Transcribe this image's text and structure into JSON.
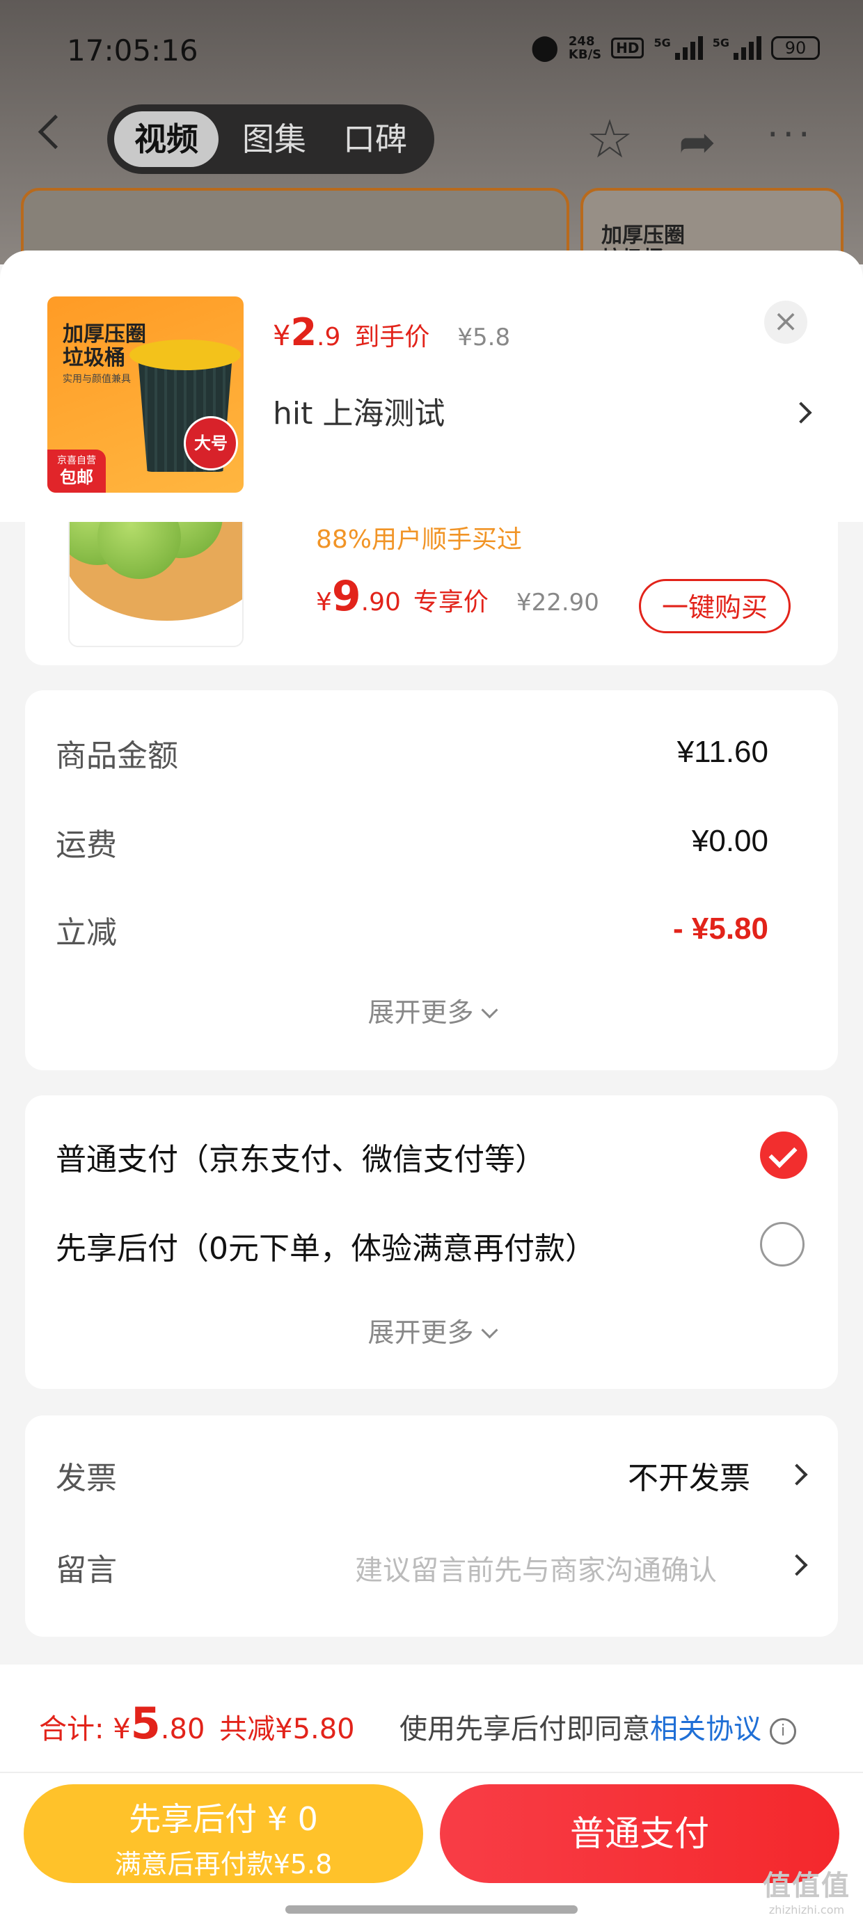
{
  "status_bar": {
    "time": "17:05:16",
    "net_speed": "248",
    "net_unit": "KB/S",
    "hd": "HD",
    "sig1": "5G",
    "sig2": "5G",
    "battery": "90"
  },
  "background": {
    "tabs": [
      {
        "label": "视频",
        "active": true
      },
      {
        "label": "图集",
        "active": false
      },
      {
        "label": "口碑",
        "active": false
      }
    ],
    "card_title": "加厚压圈\n垃圾桶"
  },
  "product": {
    "thumb_title": "加厚压圈\n垃圾桶",
    "thumb_sub": "实用与颜值兼具",
    "thumb_badge": "大号",
    "thumb_ship_top": "京喜自营",
    "thumb_ship": "包邮",
    "currency": "¥",
    "price_int": "2",
    "price_dec": ".9",
    "price_label": "到手价",
    "orig_price": "¥5.8",
    "address": "hit  上海测试"
  },
  "recommend": {
    "note": "88%用户顺手买过",
    "currency": "¥",
    "price_int": "9",
    "price_dec": ".90",
    "price_label": "专享价",
    "orig_price": "¥22.90",
    "buy_label": "一键购买"
  },
  "amounts": {
    "rows": [
      {
        "label": "商品金额",
        "value": "¥11.60"
      },
      {
        "label": "运费",
        "value": "¥0.00"
      },
      {
        "label": "立减",
        "value": "- ¥5.80"
      }
    ],
    "expand": "展开更多"
  },
  "payment": {
    "options": [
      {
        "label": "普通支付（京东支付、微信支付等）",
        "selected": true
      },
      {
        "label": "先享后付（0元下单，体验满意再付款）",
        "selected": false
      }
    ],
    "expand": "展开更多"
  },
  "invoice": {
    "label": "发票",
    "value": "不开发票"
  },
  "message": {
    "label": "留言",
    "placeholder": "建议留言前先与商家沟通确认"
  },
  "footer": {
    "total_label": "合计: ¥",
    "total_int": "5",
    "total_dec": ".80",
    "saved": "共减¥5.80",
    "agree_text": "使用先享后付即同意",
    "agree_link": "相关协议",
    "info_icon": "i",
    "btn_after_line1": "先享后付 ¥ 0",
    "btn_after_line2": "满意后再付款¥5.8",
    "btn_normal": "普通支付"
  },
  "watermark": {
    "line1": "值值值",
    "line2": "zhizhizhi.com"
  },
  "colors": {
    "accent": "#e2231a",
    "after_pay": "#ffc22a",
    "link": "#1f6fd6"
  }
}
